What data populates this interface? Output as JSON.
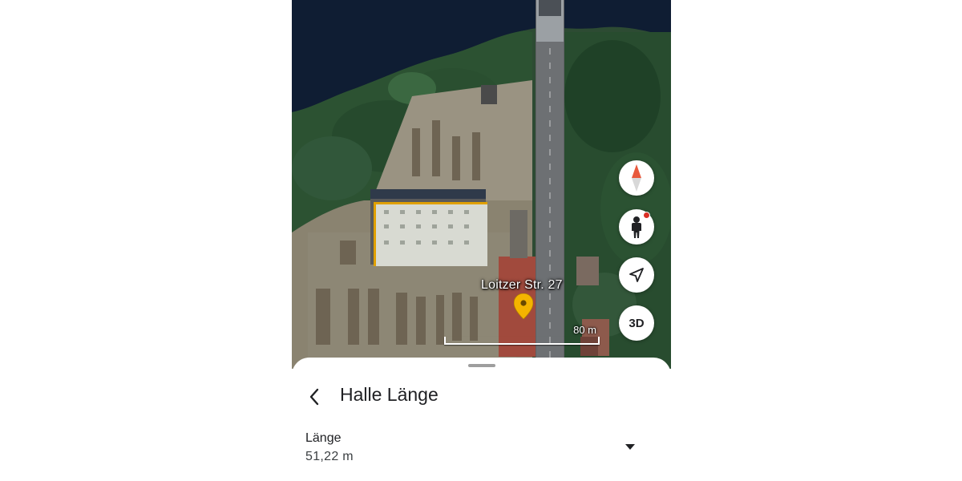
{
  "map": {
    "address_label": "Loitzer Str. 27",
    "scale_label": "80 m",
    "pin_color": "#f4b400",
    "buttons": {
      "compass_icon": "compass-icon",
      "pegman_icon": "pegman-icon",
      "locate_icon": "navigation-arrow-icon",
      "three_d_label": "3D"
    }
  },
  "sheet": {
    "back_icon": "chevron-left-icon",
    "title": "Halle Länge",
    "measurement": {
      "label": "Länge",
      "value": "51,22 m",
      "dropdown_icon": "triangle-down-icon"
    }
  }
}
